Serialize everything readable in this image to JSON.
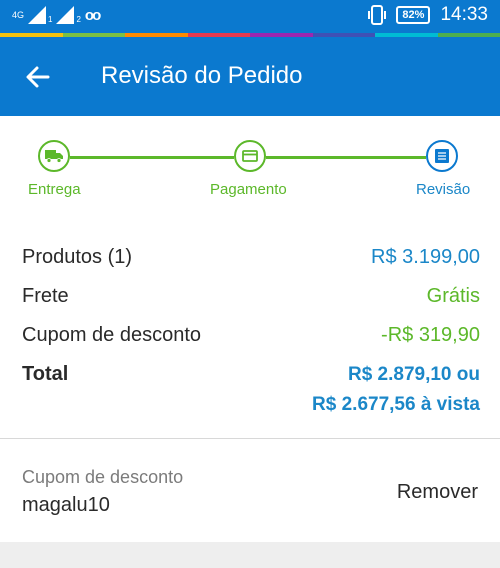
{
  "status_bar": {
    "network": "4G",
    "sim1": "1",
    "sim2": "2",
    "voicemail_icon": "voicemail-icon",
    "battery": "82%",
    "time": "14:33"
  },
  "colors": {
    "primary": "#0b79cf",
    "green": "#5cb82a",
    "link_blue": "#1b87c8",
    "rainbow": [
      "#f4c20d",
      "#7bc043",
      "#ff8a00",
      "#e8394f",
      "#9c27b0",
      "#3f51b5",
      "#00bcd4",
      "#4caf50"
    ]
  },
  "app_bar": {
    "title": "Revisão do Pedido",
    "back_icon": "arrow-left-icon"
  },
  "stepper": {
    "steps": [
      {
        "label": "Entrega",
        "icon": "truck-icon",
        "state": "done"
      },
      {
        "label": "Pagamento",
        "icon": "card-icon",
        "state": "done"
      },
      {
        "label": "Revisão",
        "icon": "list-icon",
        "state": "current"
      }
    ]
  },
  "summary": {
    "products_label": "Produtos (1)",
    "products_value": "R$ 3.199,00",
    "shipping_label": "Frete",
    "shipping_value": "Grátis",
    "coupon_label": "Cupom de desconto",
    "coupon_value": "-R$ 319,90",
    "total_label": "Total",
    "total_value_line1": "R$ 2.879,10 ou",
    "total_value_line2": "R$ 2.677,56 à vista"
  },
  "coupon": {
    "label": "Cupom de desconto",
    "code": "magalu10",
    "remove_label": "Remover"
  }
}
